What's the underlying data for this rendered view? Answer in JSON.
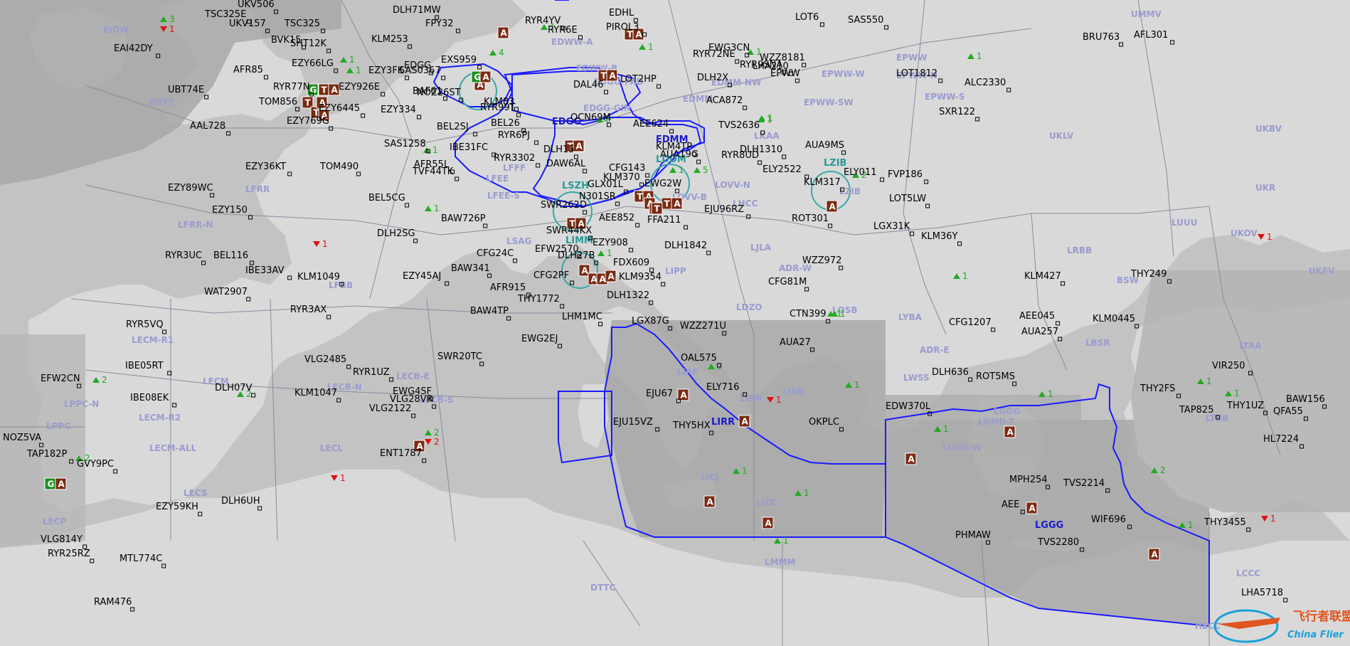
{
  "watermark": {
    "cn": "飞行者联盟",
    "en": "China Flier"
  },
  "fir_labels": [
    {
      "id": "edgg",
      "text": "EDGG"
    },
    {
      "id": "edmm",
      "text": "EDMM"
    },
    {
      "id": "lszh",
      "text": "LSZH"
    },
    {
      "id": "ldm",
      "text": "LDDM"
    },
    {
      "id": "limm",
      "text": "LIMM"
    },
    {
      "id": "lzib",
      "text": "LZIB"
    },
    {
      "id": "lirr",
      "text": "LIRR"
    },
    {
      "id": "lggg",
      "text": "LGGG"
    }
  ],
  "sector_labels": [
    "UMMV",
    "EPWW-N",
    "EPWW",
    "EPWW-W",
    "EPWW-S",
    "UKLV",
    "UKBV",
    "EIDW",
    "EGTT",
    "EDWW-A",
    "EDWW-B",
    "EDDV",
    "EDGG-PAD",
    "EDGG-GIN",
    "EDMM",
    "EDMM-NW",
    "EPWW-SW",
    "LKAA",
    "LFFF",
    "LFEE",
    "LFEE-S",
    "LSAG",
    "LFRR",
    "LFRR-N",
    "LFBB",
    "LOVV-B",
    "LOVV-N",
    "LHCC",
    "LZIB",
    "UKR",
    "LUUU",
    "UKOV",
    "UKFV",
    "LRBB",
    "BSW",
    "LJLA",
    "LIPP",
    "ADR-W",
    "LDZO",
    "LQSB",
    "LYBA",
    "ADR-E",
    "LBSR",
    "LWSS",
    "LGGG",
    "LGMD-T",
    "LGGG-W",
    "LTBB",
    "LTAA",
    "LIRF",
    "LIRN",
    "LIBB",
    "LICJ",
    "LICC",
    "LMMM",
    "LECM-R1",
    "LECM",
    "LECM-R2",
    "LECM-ALL",
    "LECB-N",
    "LECB-E",
    "LECB-S",
    "LPPC-N",
    "LPPC",
    "LECS",
    "LECL",
    "LECP",
    "DTTC",
    "LCCC",
    "HECC"
  ],
  "callsigns": [
    "UKV506",
    "TSC325E",
    "UKV157",
    "TSC325",
    "DLH71MW",
    "FPY32",
    "RYR4YV",
    "RYR6E",
    "EDHL",
    "LOT6",
    "SAS550",
    "BRU763",
    "AFL301",
    "EAI42DY",
    "BVK15",
    "SHT12K",
    "KLM253",
    "PIROL3",
    "EWG3CN",
    "RYR72NE",
    "WZZ8181",
    "RYR9SNA",
    "LHA210",
    "EXS959",
    "EDGG",
    "AFR85",
    "EZY3FK",
    "SAS0367",
    "EZY66LG",
    "LOT2HP",
    "DLH2X",
    "EPWW",
    "LOT1812",
    "ALC2330",
    "UBT74E",
    "RYR77N",
    "EZY926E",
    "BAF61",
    "NOZ26ST",
    "DAL46",
    "KLM83",
    "ACA872",
    "SXR122",
    "TOM856",
    "EZY6445",
    "EZY334",
    "RYR99T",
    "AAL728",
    "EZY769G",
    "BEL2SJ",
    "BEL26",
    "AEE624",
    "OCN69M",
    "TVS2636",
    "RYR6PJ",
    "SAS1258",
    "IBE31FC",
    "RYR3302",
    "KLM4TP",
    "DLH1310",
    "AUA9MS",
    "AFR55L",
    "TVF44TK",
    "DLH15",
    "DAW6AL",
    "AUA19G",
    "RYR8UD",
    "ELY2522",
    "KLM317",
    "ELY011",
    "FVP186",
    "EZY36KT",
    "TOM490",
    "CFG143",
    "KLM370",
    "GLX01L",
    "LOT5LW",
    "EZY89WC",
    "BEL5CG",
    "N301SR",
    "EWG2W",
    "EJU96RZ",
    "EZY150",
    "SWR262D",
    "AEE852",
    "FFA211",
    "ROT301",
    "LGX31K",
    "BAW726P",
    "SWR44KX",
    "KLM36Y",
    "RYR3UC",
    "BEL116",
    "DLH2SG",
    "EZY908",
    "DLH1842",
    "IBE33AV",
    "DLH27B",
    "CFG24C",
    "EFW2570",
    "FDX609",
    "WZZ972",
    "KLM427",
    "THY249",
    "KLM1049",
    "WAT2907",
    "BAW341",
    "EZY45AJ",
    "CFG2PF",
    "KLM9354",
    "CFG81M",
    "AFR915",
    "THY1772",
    "DLH1322",
    "RYR3AX",
    "BAW4TP",
    "CTN399",
    "AEE045",
    "KLM0445",
    "RYR5VQ",
    "LHM1MC",
    "LGX87G",
    "CFG1207",
    "AUA257",
    "WZZ271U",
    "AUA27",
    "EWG2EJ",
    "SWR20TC",
    "VLG2485",
    "OAL575",
    "DLH636",
    "ROT5MS",
    "VIR250",
    "EFW2CN",
    "IBE05RT",
    "RYR1UZ",
    "DLH07V",
    "THY2FS",
    "BAW156",
    "ELY716",
    "KLM1047",
    "EWG4SF",
    "VLG28VR",
    "IBE08EK",
    "EJU67",
    "TAP825",
    "THY1UZ",
    "QFA55",
    "VLG2122",
    "EJU15VZ",
    "THY5HX",
    "OKPLC",
    "EDW370L",
    "HL7224",
    "NOZ5VA",
    "ENT1787",
    "TAP182P",
    "GVY9PC",
    "MPH254",
    "TVS2214",
    "EZY59KH",
    "DLH6UH",
    "AEE",
    "WIF696",
    "THY3455",
    "VLG814Y",
    "PHMAW",
    "TVS2280",
    "RYR25RZ",
    "MTL774C",
    "LHA5718",
    "RAM476"
  ],
  "traffic_counts": {
    "eidw_up": "3",
    "eidw_down": "1",
    "egtt_up": "4",
    "edgg_up": "6",
    "edmm_up": "5",
    "lkaa": "1",
    "lzib_up": "2",
    "ldm_up": "1",
    "ukov_down": "1",
    "lfrr_down": "1",
    "lirf_up": "2",
    "lirn_down": "1",
    "lecb_up": "2",
    "lecb_down": "2",
    "lpp_up": "2",
    "lecp_down": "1",
    "libb_up": "1",
    "licc_up": "1",
    "lmmm_up": "1",
    "lgmd_up": "1",
    "ltbb_up": "2",
    "lty_up": "1",
    "lta_down": "1",
    "lgg_up": "1",
    "licj_up": "1",
    "lyba_up": "1",
    "adr_up": "1",
    "eyvi_up": "1",
    "lfee_up": "1",
    "lffs_up": "1",
    "epww_up": "1",
    "lsn_up": "1",
    "edww_up": "1",
    "edmm_w_up": "1",
    "lww_up": "1",
    "egpx_up": "2",
    "egtt2_up": "1",
    "egtt3_up": "1",
    "lpp2_up": "2",
    "lsgg_up": "1",
    "lims_up": "1",
    "lyb2_up": "1"
  },
  "airport_badges": [
    "T",
    "A",
    "G"
  ],
  "colors": {
    "water": "#c8c8c8",
    "land": "#d6d6d6",
    "land_dark": "#a6a6a6",
    "route": "#1a1aff",
    "circle": "#3aa7a7",
    "up": "#22aa22",
    "down": "#dd1111",
    "badge": "#7a2a12",
    "badge_g": "#1b8f1b"
  }
}
